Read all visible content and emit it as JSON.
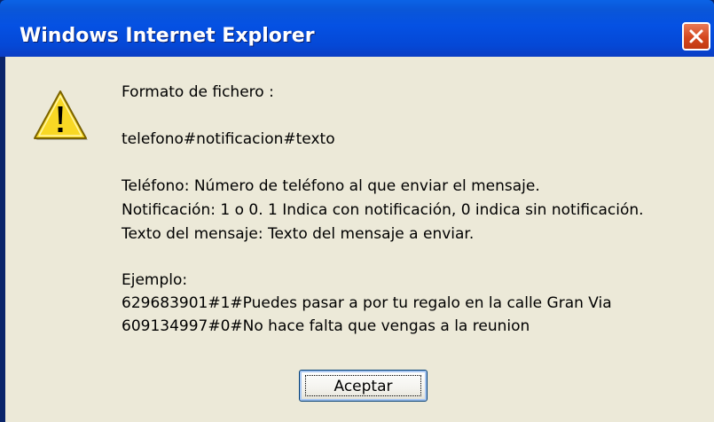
{
  "window": {
    "title": "Windows Internet Explorer"
  },
  "icons": {
    "close": "close-icon",
    "warning": "warning-icon"
  },
  "message": {
    "lines": [
      "Formato de fichero :",
      "telefono#notificacion#texto",
      "Teléfono: Número de teléfono al que enviar el mensaje.",
      "Notificación: 1 o 0. 1 Indica con notificación, 0 indica sin notificación.",
      "Texto del mensaje: Texto del mensaje a enviar.",
      "Ejemplo:",
      "629683901#1#Puedes pasar a por tu regalo en la calle Gran Via",
      "609134997#0#No hace falta que vengas a la reunion"
    ]
  },
  "buttons": {
    "ok_label": "Aceptar"
  },
  "colors": {
    "titlebar": "#0551e3",
    "client_background": "#ece9d8",
    "close_button": "#d4471e",
    "warning_yellow": "#f8d824"
  }
}
